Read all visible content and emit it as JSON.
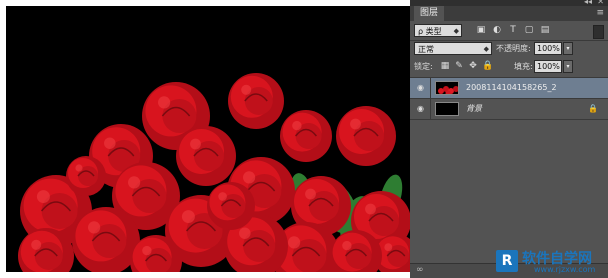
{
  "panel": {
    "title": "图层",
    "collapse_glyph": "◂◂",
    "close_glyph": "✕",
    "menu_glyph": "≡",
    "filter": {
      "label": "ρ 类型",
      "icons": [
        "image-filter-icon",
        "adjustment-filter-icon",
        "type-filter-icon",
        "shape-filter-icon",
        "smart-object-filter-icon"
      ]
    },
    "blend_mode": "正常",
    "opacity_label": "不透明度:",
    "opacity_value": "100%",
    "lock_label": "锁定:",
    "fill_label": "填充:",
    "fill_value": "100%",
    "layers": [
      {
        "name": "2008114104158265_2",
        "active": true,
        "visible": true,
        "thumbnail": "roses"
      },
      {
        "name": "背景",
        "active": false,
        "visible": true,
        "locked": true,
        "thumbnail": "black"
      }
    ],
    "link_glyph": "∞"
  },
  "watermark": {
    "logo_letter": "R",
    "title": "软件自学网",
    "url": "www.rjzxw.com"
  },
  "colors": {
    "panel_bg": "#535353",
    "active_layer": "#6e7e91",
    "rose_red": "#d8141e",
    "leaf_green": "#2e7d32",
    "watermark_blue": "#1b75bc"
  }
}
